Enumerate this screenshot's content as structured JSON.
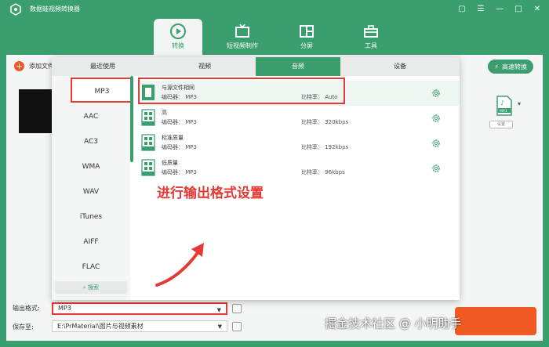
{
  "app": {
    "title": "数据蛙视频转换器"
  },
  "window": {
    "icons": [
      "chat-icon",
      "menu-icon",
      "minimize-icon",
      "maximize-icon",
      "close-icon"
    ]
  },
  "main_tabs": [
    {
      "label": "转换",
      "icon": "convert-icon",
      "active": true
    },
    {
      "label": "短视频制作",
      "icon": "tv-icon",
      "active": false
    },
    {
      "label": "分屏",
      "icon": "split-icon",
      "active": false
    },
    {
      "label": "工具",
      "icon": "toolbox-icon",
      "active": false
    }
  ],
  "toolbar": {
    "add_label": "添加文件",
    "fast_label": "高速转换"
  },
  "format_panel": {
    "tabs": [
      {
        "label": "最近使用",
        "active": false
      },
      {
        "label": "视频",
        "active": false
      },
      {
        "label": "音频",
        "active": true
      },
      {
        "label": "设备",
        "active": false
      }
    ],
    "categories": [
      "MP3",
      "AAC",
      "AC3",
      "WMA",
      "WAV",
      "iTunes",
      "AIFF",
      "FLAC"
    ],
    "selected_category": "MP3",
    "search_label": "搜索",
    "presets": [
      {
        "name": "与源文件相同",
        "encoder": "编码器：  MP3",
        "bitrate": "比特率：    Auto",
        "icon": "same-source-icon"
      },
      {
        "name": "高",
        "encoder": "编码器：  MP3",
        "bitrate": "比特率：    320kbps",
        "icon": "high-quality-icon"
      },
      {
        "name": "标准质量",
        "encoder": "编码器：  MP3",
        "bitrate": "比特率：    192kbps",
        "icon": "standard-quality-icon"
      },
      {
        "name": "低质量",
        "encoder": "编码器：  MP3",
        "bitrate": "比特率：    96kbps",
        "icon": "low-quality-icon"
      }
    ]
  },
  "annotation": "进行输出格式设置",
  "file_item": {
    "format_badge": "MP3",
    "settings_label": "设置"
  },
  "bottom": {
    "output_label": "输出格式:",
    "output_value": "MP3",
    "save_label": "保存至:",
    "save_path": "E:\\PrMaterial\\图片与视频素材"
  },
  "watermark": "掘金技术社区 @ 小明助手",
  "colors": {
    "brand": "#3a9e6e",
    "accent": "#f05a22",
    "highlight": "#e53935"
  }
}
